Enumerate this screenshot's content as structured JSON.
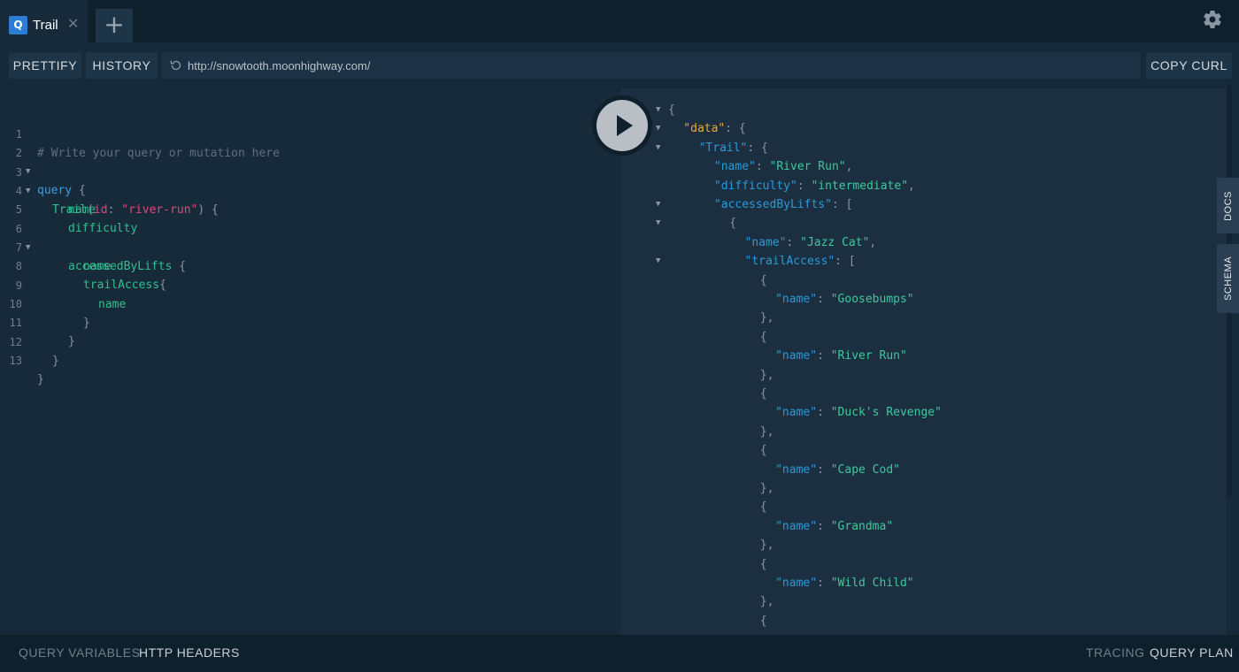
{
  "tabs": [
    {
      "icon_letter": "Q",
      "title": "Trail",
      "close": "✕"
    }
  ],
  "add_tab_label": "+",
  "toolbar": {
    "prettify": "PRETTIFY",
    "history": "HISTORY",
    "url": "http://snowtooth.moonhighway.com/",
    "copy_curl": "COPY CURL"
  },
  "query_lines": [
    "# Write your query or mutation here",
    "query {",
    "Trail(id: \"river-run\") {",
    "name",
    "difficulty",
    "accessedByLifts {",
    "name",
    "trailAccess{",
    "name",
    "}",
    "}",
    "}",
    "}"
  ],
  "result_lines": [
    "{",
    "\"data\": {",
    "\"Trail\": {",
    "\"name\": \"River Run\",",
    "\"difficulty\": \"intermediate\",",
    "\"accessedByLifts\": [",
    "{",
    "\"name\": \"Jazz Cat\",",
    "\"trailAccess\": [",
    "{",
    "\"name\": \"Goosebumps\"",
    "},",
    "{",
    "\"name\": \"River Run\"",
    "},",
    "{",
    "\"name\": \"Duck's Revenge\"",
    "},",
    "{",
    "\"name\": \"Cape Cod\"",
    "},",
    "{",
    "\"name\": \"Grandma\"",
    "},",
    "{",
    "\"name\": \"Wild Child\"",
    "},",
    "{"
  ],
  "side_tabs": {
    "docs": "DOCS",
    "schema": "SCHEMA"
  },
  "bottom": {
    "query_variables": "QUERY VARIABLES",
    "http_headers": "HTTP HEADERS",
    "tracing": "TRACING",
    "query_plan": "QUERY PLAN"
  },
  "icons": {
    "settings": "gear-icon",
    "run": "play-icon",
    "reload": "reload-icon"
  },
  "colors": {
    "accent": "#2a7ed3",
    "keyword": "#3f9de0",
    "field": "#30c08d",
    "string": "#e0467b",
    "data_key": "#f2a630"
  }
}
